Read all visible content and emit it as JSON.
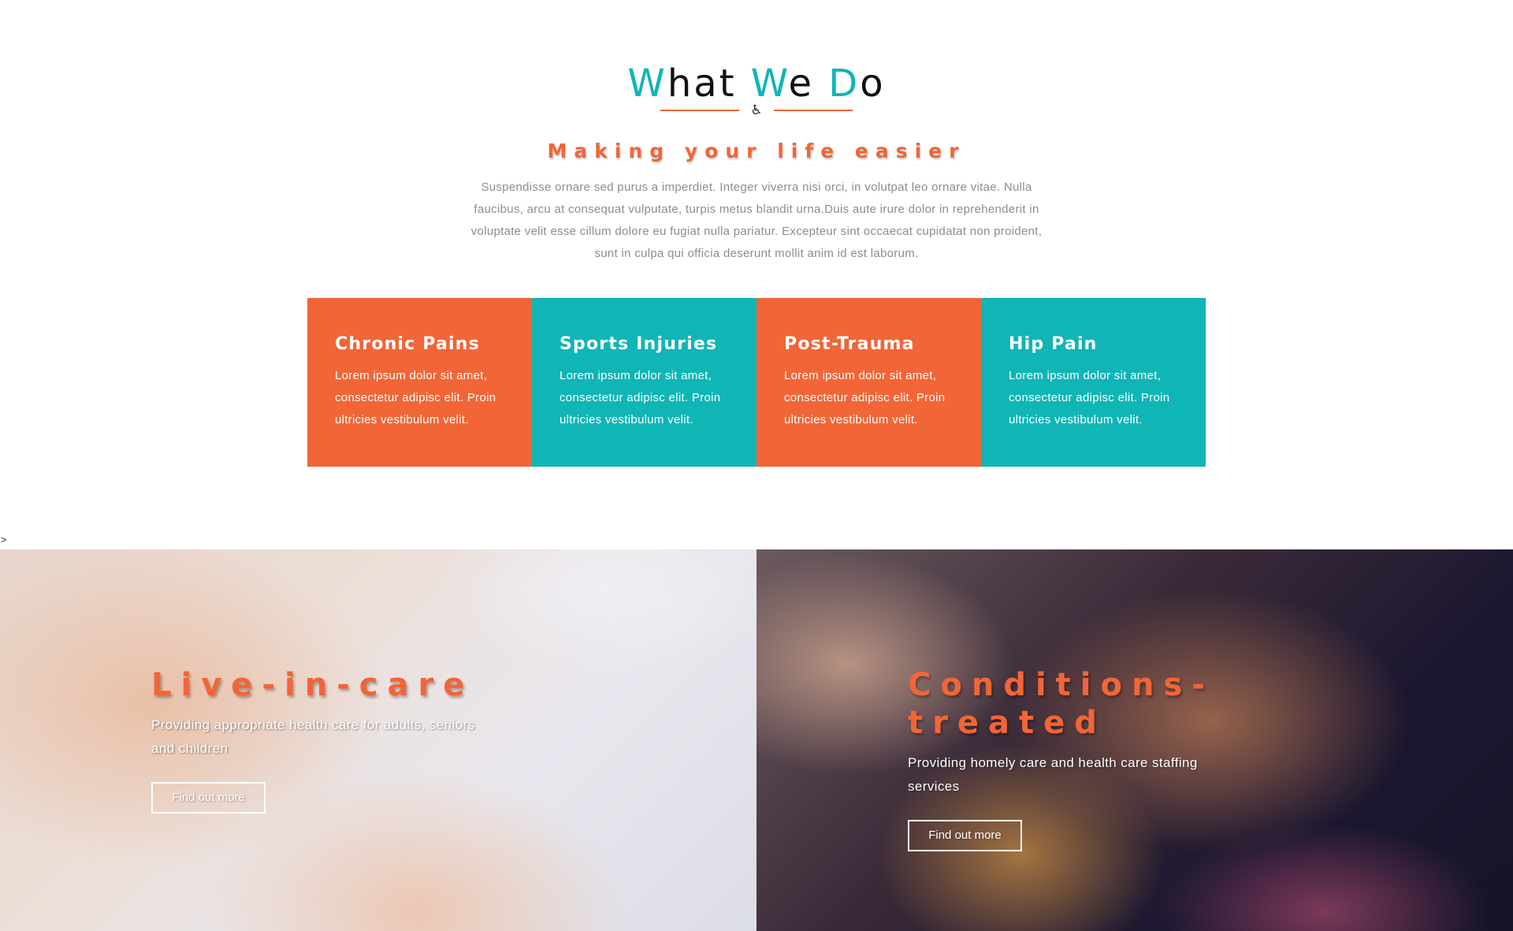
{
  "header": {
    "title_parts": [
      {
        "text": "W",
        "accent": true
      },
      {
        "text": "hat ",
        "accent": false
      },
      {
        "text": "W",
        "accent": true
      },
      {
        "text": "e ",
        "accent": false
      },
      {
        "text": "D",
        "accent": true
      },
      {
        "text": "o",
        "accent": false
      }
    ],
    "divider_icon": "♿",
    "divider_icon_name": "wheelchair-icon",
    "subtitle": "Making your life easier",
    "intro": "Suspendisse ornare sed purus a imperdiet. Integer viverra nisi orci, in volutpat leo ornare vitae. Nulla faucibus, arcu at consequat vulputate, turpis metus blandit urna.Duis aute irure dolor in reprehenderit in voluptate velit esse cillum dolore eu fugiat nulla pariatur. Excepteur sint occaecat cupidatat non proident, sunt in culpa qui officia deserunt mollit anim id est laborum."
  },
  "services": [
    {
      "title": "Chronic Pains",
      "text": "Lorem ipsum dolor sit amet, consectetur adipisc elit. Proin ultricies vestibulum velit.",
      "color": "orange"
    },
    {
      "title": "Sports Injuries",
      "text": "Lorem ipsum dolor sit amet, consectetur adipisc elit. Proin ultricies vestibulum velit.",
      "color": "teal"
    },
    {
      "title": "Post-Trauma",
      "text": "Lorem ipsum dolor sit amet, consectetur adipisc elit. Proin ultricies vestibulum velit.",
      "color": "orange"
    },
    {
      "title": "Hip Pain",
      "text": "Lorem ipsum dolor sit amet, consectetur adipisc elit. Proin ultricies vestibulum velit.",
      "color": "teal"
    }
  ],
  "stray_text": ">",
  "panels": [
    {
      "title": "Live-in-care",
      "text": "Providing appropriate health care for adults, seniors and children",
      "button": "Find out more"
    },
    {
      "title": "Conditions-treated",
      "text": "Providing homely care and health care staffing services",
      "button": "Find out more"
    }
  ],
  "colors": {
    "accent_orange": "#f26537",
    "accent_teal": "#10b5b6",
    "body_text": "#8d8d8d"
  }
}
